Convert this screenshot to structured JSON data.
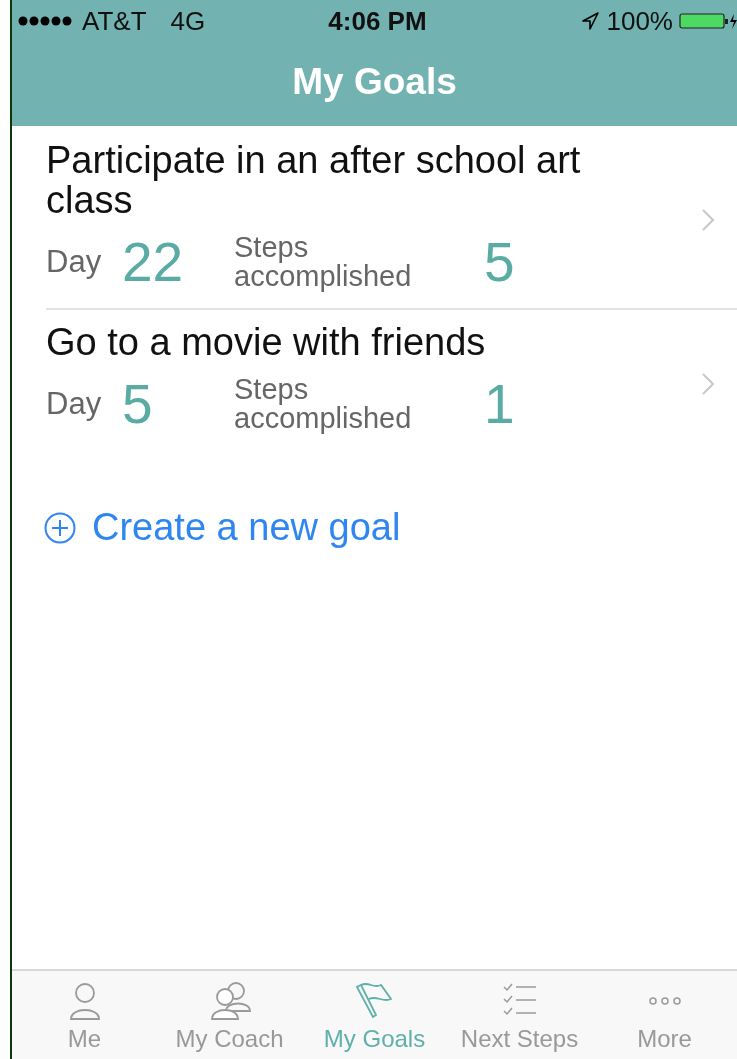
{
  "status_bar": {
    "carrier": "AT&T",
    "network": "4G",
    "time": "4:06 PM",
    "battery": "100%"
  },
  "nav_bar": {
    "title": "My Goals"
  },
  "goals": [
    {
      "title": "Participate in an after school art class",
      "day_label": "Day",
      "day": "22",
      "steps_label": "Steps accomplished",
      "steps": "5"
    },
    {
      "title": "Go to a movie with friends",
      "day_label": "Day",
      "day": "5",
      "steps_label": "Steps accomplished",
      "steps": "1"
    }
  ],
  "create_button": {
    "label": "Create a new goal"
  },
  "tab_bar": [
    {
      "label": "Me",
      "kind": "person",
      "selected": false
    },
    {
      "label": "My Coach",
      "kind": "people",
      "selected": false
    },
    {
      "label": "My Goals",
      "kind": "flag",
      "selected": true
    },
    {
      "label": "Next Steps",
      "kind": "checklist",
      "selected": false
    },
    {
      "label": "More",
      "kind": "more",
      "selected": false
    }
  ]
}
